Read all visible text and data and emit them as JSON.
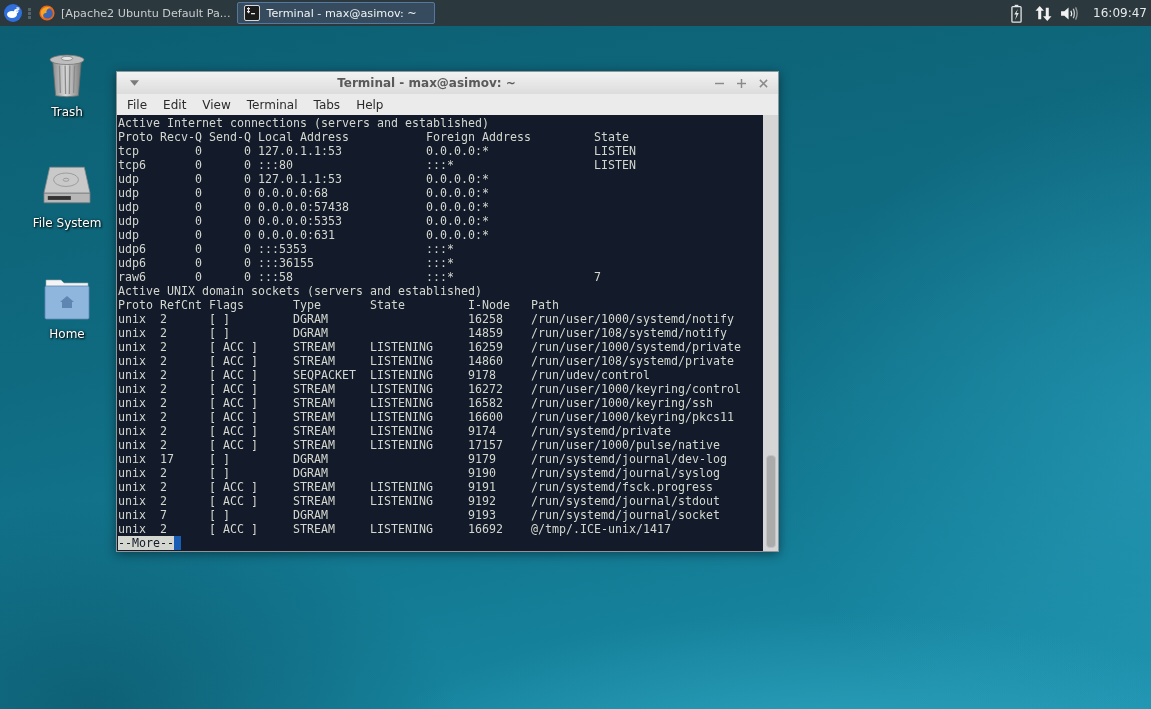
{
  "panel": {
    "tasks": [
      {
        "kind": "browser",
        "title": "[Apache2 Ubuntu Default Pa...",
        "selected": false
      },
      {
        "kind": "terminal",
        "title": "Terminal - max@asimov: ~",
        "selected": true
      }
    ],
    "clock": "16:09:47"
  },
  "desktop_icons": [
    {
      "kind": "trash",
      "label": "Trash"
    },
    {
      "kind": "drive",
      "label": "File System"
    },
    {
      "kind": "folder",
      "label": "Home"
    }
  ],
  "window": {
    "title": "Terminal - max@asimov: ~",
    "menu": [
      "File",
      "Edit",
      "View",
      "Terminal",
      "Tabs",
      "Help"
    ],
    "lines": [
      "Active Internet connections (servers and established)",
      "Proto Recv-Q Send-Q Local Address           Foreign Address         State",
      "tcp        0      0 127.0.1.1:53            0.0.0.0:*               LISTEN",
      "tcp6       0      0 :::80                   :::*                    LISTEN",
      "udp        0      0 127.0.1.1:53            0.0.0.0:*",
      "udp        0      0 0.0.0.0:68              0.0.0.0:*",
      "udp        0      0 0.0.0.0:57438           0.0.0.0:*",
      "udp        0      0 0.0.0.0:5353            0.0.0.0:*",
      "udp        0      0 0.0.0.0:631             0.0.0.0:*",
      "udp6       0      0 :::5353                 :::*",
      "udp6       0      0 :::36155                :::*",
      "raw6       0      0 :::58                   :::*                    7",
      "Active UNIX domain sockets (servers and established)",
      "Proto RefCnt Flags       Type       State         I-Node   Path",
      "unix  2      [ ]         DGRAM                    16258    /run/user/1000/systemd/notify",
      "unix  2      [ ]         DGRAM                    14859    /run/user/108/systemd/notify",
      "unix  2      [ ACC ]     STREAM     LISTENING     16259    /run/user/1000/systemd/private",
      "unix  2      [ ACC ]     STREAM     LISTENING     14860    /run/user/108/systemd/private",
      "unix  2      [ ACC ]     SEQPACKET  LISTENING     9178     /run/udev/control",
      "unix  2      [ ACC ]     STREAM     LISTENING     16272    /run/user/1000/keyring/control",
      "unix  2      [ ACC ]     STREAM     LISTENING     16582    /run/user/1000/keyring/ssh",
      "unix  2      [ ACC ]     STREAM     LISTENING     16600    /run/user/1000/keyring/pkcs11",
      "unix  2      [ ACC ]     STREAM     LISTENING     9174     /run/systemd/private",
      "unix  2      [ ACC ]     STREAM     LISTENING     17157    /run/user/1000/pulse/native",
      "unix  17     [ ]         DGRAM                    9179     /run/systemd/journal/dev-log",
      "unix  2      [ ]         DGRAM                    9190     /run/systemd/journal/syslog",
      "unix  2      [ ACC ]     STREAM     LISTENING     9191     /run/systemd/fsck.progress",
      "unix  2      [ ACC ]     STREAM     LISTENING     9192     /run/systemd/journal/stdout",
      "unix  7      [ ]         DGRAM                    9193     /run/systemd/journal/socket",
      "unix  2      [ ACC ]     STREAM     LISTENING     16692    @/tmp/.ICE-unix/1417"
    ],
    "prompt": "--More--"
  }
}
